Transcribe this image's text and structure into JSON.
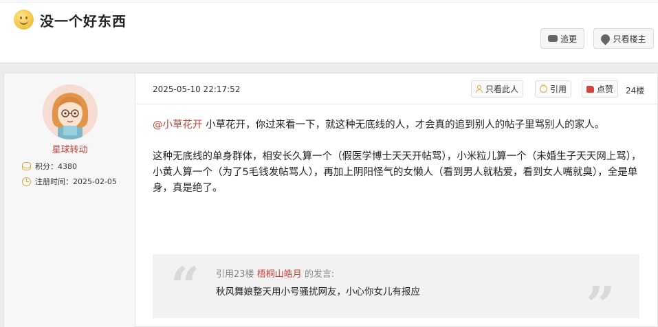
{
  "header": {
    "title": "没一个好东西",
    "follow_label": "追更",
    "louzhu_label": "只看楼主"
  },
  "author": {
    "name": "星球转动",
    "points_label": "积分：",
    "points": "4380",
    "reg_label": "注册时间：",
    "reg_date": "2025-02-05"
  },
  "post": {
    "datetime": "2025-05-10 22:17:52",
    "only_this_label": "只看此人",
    "quote_label": "引用",
    "like_label": "点赞",
    "floor": "24楼",
    "mention": "@小草花开",
    "para1_rest": " 小草花开，你过来看一下，就这种无底线的人，才会真的追到别人的帖子里骂别人的家人。",
    "para2": "这种无底线的单身群体，相安长久算一个（假医学博士天天开帖骂），小米粒儿算一个（未婚生子天天网上骂），小黄人算一个（为了5毛钱发帖骂人），再加上阴阳怪气的女懒人（看到男人就粘爱，看到女人嘴就臭），全是单身，真是绝了。"
  },
  "quote": {
    "prefix": "引用23楼 ",
    "user": "梧桐山皓月",
    "suffix": " 的发言:",
    "text": "秋风舞娘整天用小号骚扰网友，小心你女儿有报应"
  },
  "colors": {
    "accent_red": "#c2413b",
    "icon_orange": "#e0a33a"
  }
}
